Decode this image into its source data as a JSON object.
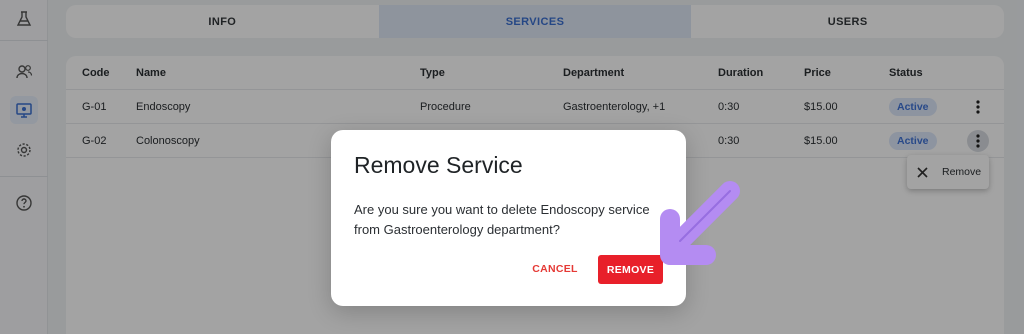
{
  "tabs": [
    {
      "label": "INFO"
    },
    {
      "label": "SERVICES",
      "active": true
    },
    {
      "label": "USERS"
    }
  ],
  "table": {
    "headers": [
      "Code",
      "Name",
      "Type",
      "Department",
      "Duration",
      "Price",
      "Status"
    ],
    "rows": [
      {
        "code": "G-01",
        "name": "Endoscopy",
        "type": "Procedure",
        "department": "Gastroenterology, +1",
        "duration": "0:30",
        "price": "$15.00",
        "status": "Active"
      },
      {
        "code": "G-02",
        "name": "Colonoscopy",
        "type": "",
        "department": "",
        "duration": "0:30",
        "price": "$15.00",
        "status": "Active"
      }
    ]
  },
  "row_menu": {
    "remove_label": "Remove"
  },
  "dialog": {
    "title": "Remove Service",
    "message": "Are you sure you want to delete Endoscopy service from Gastroenterology department?",
    "cancel_label": "CANCEL",
    "remove_label": "REMOVE"
  },
  "sidebar": {
    "icons": [
      "lab-flask-icon",
      "users-icon",
      "monitor-icon",
      "gear-icon",
      "help-icon"
    ]
  },
  "colors": {
    "accent": "#3b6fd1",
    "danger": "#e8202a",
    "annotation_arrow": "#b48cf2"
  }
}
